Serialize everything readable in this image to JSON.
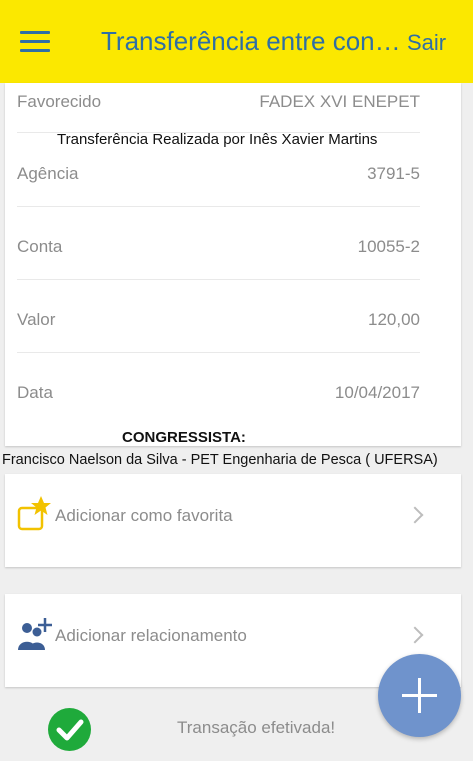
{
  "header": {
    "title": "Transferência entre contas",
    "exit_label": "Sair",
    "menu_icon": "hamburger-menu-icon",
    "bg_color": "#fbe800",
    "text_color": "#2f6fa4"
  },
  "details": {
    "rows": [
      {
        "label": "Favorecido",
        "value": "FADEX XVI ENEPET"
      },
      {
        "label": "Agência",
        "value": "3791-5"
      },
      {
        "label": "Conta",
        "value": "10055-2"
      },
      {
        "label": "Valor",
        "value": "120,00"
      },
      {
        "label": "Data",
        "value": "10/04/2017"
      }
    ]
  },
  "overlays": {
    "transfer_note": "Transferência Realizada por Inês Xavier Martins",
    "congress_heading": "CONGRESSISTA:",
    "congress_name": "Francisco Naelson da Silva - PET Engenharia de Pesca  ( UFERSA)"
  },
  "actions": {
    "favorite": {
      "label": "Adicionar como favorita",
      "icon": "star-folder-icon"
    },
    "relationship": {
      "label": "Adicionar relacionamento",
      "icon": "add-contacts-icon"
    }
  },
  "fab": {
    "icon": "plus-icon",
    "color": "#6f93cc"
  },
  "status": {
    "message": "Transação efetivada!",
    "icon": "check-circle-icon",
    "color": "#1faa3b"
  }
}
